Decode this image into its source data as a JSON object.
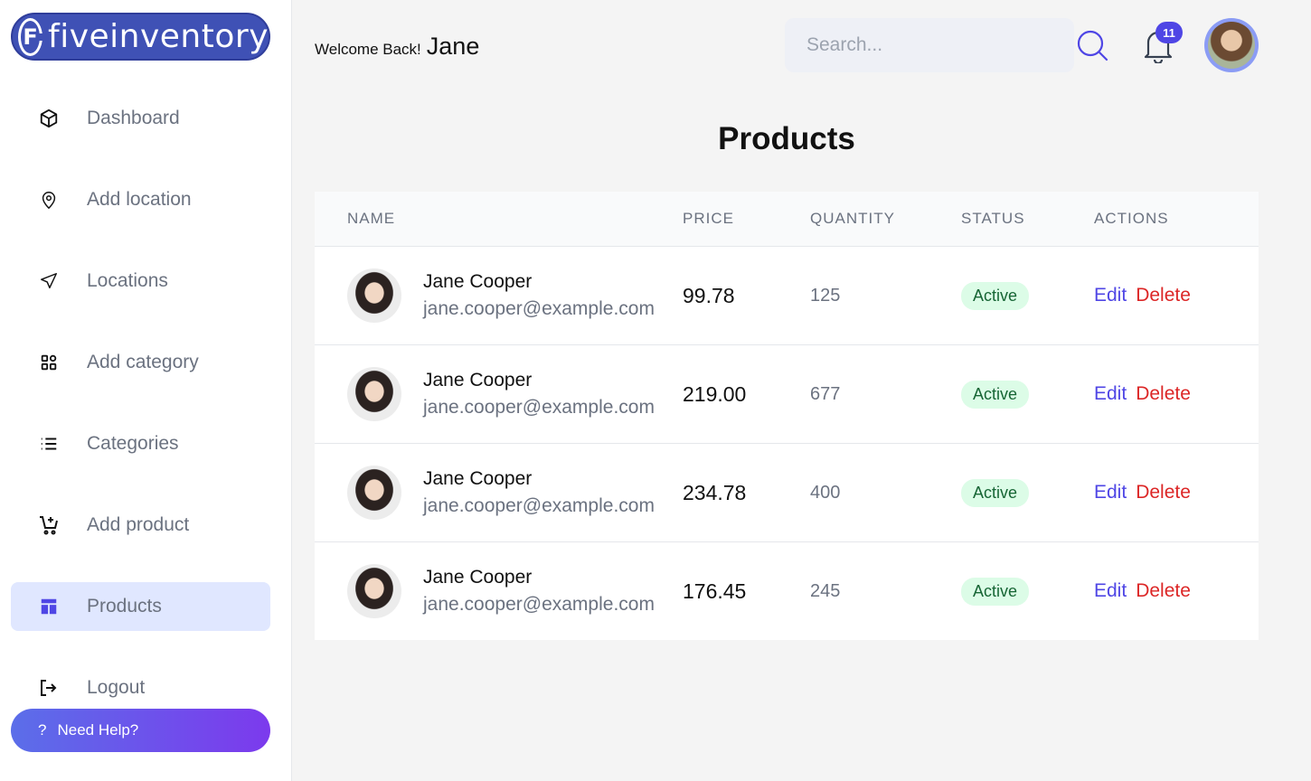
{
  "brand": {
    "logo_mark": "F",
    "name": "fiveinventory"
  },
  "sidebar": {
    "items": [
      {
        "label": "Dashboard",
        "icon": "cube-icon"
      },
      {
        "label": "Add location",
        "icon": "map-pin-icon"
      },
      {
        "label": "Locations",
        "icon": "send-icon"
      },
      {
        "label": "Add category",
        "icon": "grid-icon"
      },
      {
        "label": "Categories",
        "icon": "list-icon"
      },
      {
        "label": "Add product",
        "icon": "cart-add-icon"
      },
      {
        "label": "Products",
        "icon": "layout-icon",
        "active": true
      },
      {
        "label": "Logout",
        "icon": "logout-icon"
      }
    ],
    "help": {
      "mark": "?",
      "label": "Need Help?"
    }
  },
  "header": {
    "welcome": "Welcome Back!",
    "user_name": "Jane",
    "search_placeholder": "Search...",
    "notification_count": "11"
  },
  "page": {
    "title": "Products"
  },
  "table": {
    "columns": [
      "NAME",
      "PRICE",
      "QUANTITY",
      "STATUS",
      "ACTIONS"
    ],
    "rows": [
      {
        "name": "Jane Cooper",
        "email": "jane.cooper@example.com",
        "price": "99.78",
        "quantity": "125",
        "status": "Active",
        "edit": "Edit",
        "delete": "Delete"
      },
      {
        "name": "Jane Cooper",
        "email": "jane.cooper@example.com",
        "price": "219.00",
        "quantity": "677",
        "status": "Active",
        "edit": "Edit",
        "delete": "Delete"
      },
      {
        "name": "Jane Cooper",
        "email": "jane.cooper@example.com",
        "price": "234.78",
        "quantity": "400",
        "status": "Active",
        "edit": "Edit",
        "delete": "Delete"
      },
      {
        "name": "Jane Cooper",
        "email": "jane.cooper@example.com",
        "price": "176.45",
        "quantity": "245",
        "status": "Active",
        "edit": "Edit",
        "delete": "Delete"
      }
    ]
  },
  "colors": {
    "accent": "#4f46e5",
    "brand": "#3f51b5",
    "danger": "#dc2626",
    "success_bg": "#dcfce7",
    "success_text": "#166534"
  }
}
